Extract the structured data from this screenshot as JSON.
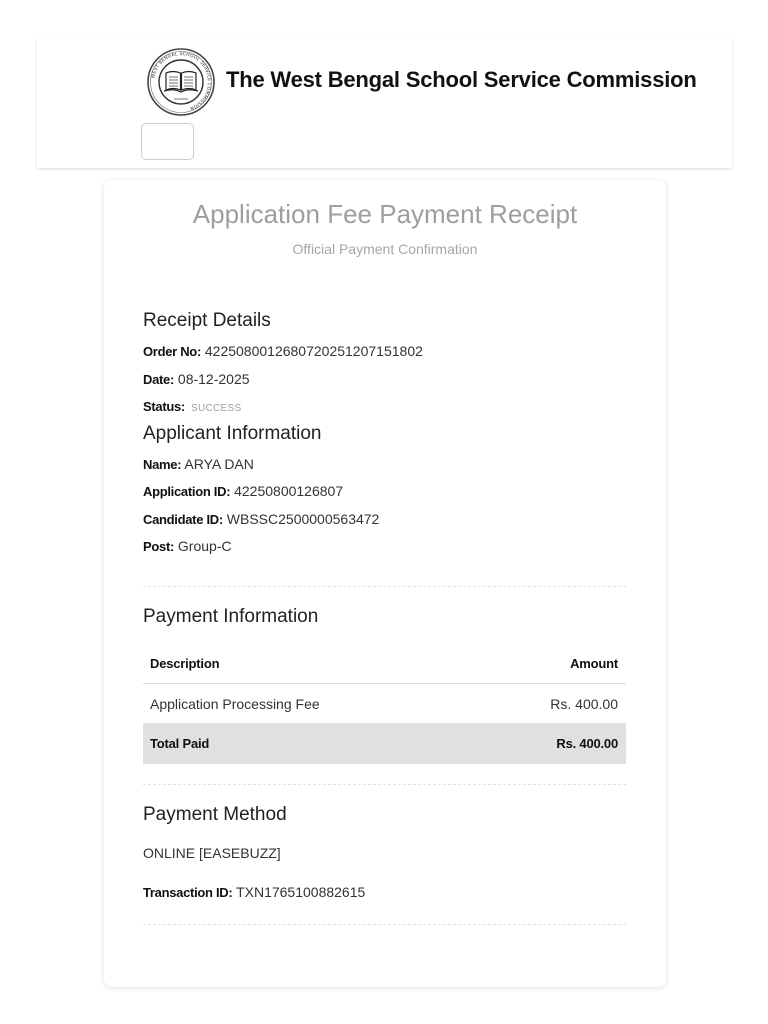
{
  "header": {
    "org_name": "The West Bengal School Service Commission",
    "seal_text": "WEST BENGAL SCHOOL SERVICE COMMISSION"
  },
  "receipt": {
    "title": "Application Fee Payment Receipt",
    "subtitle": "Official Payment Confirmation"
  },
  "receipt_details": {
    "heading": "Receipt Details",
    "order_no_label": "Order No:",
    "order_no": "4225080012680720251207151802",
    "date_label": "Date:",
    "date": "08-12-2025",
    "status_label": "Status:",
    "status": "SUCCESS"
  },
  "applicant": {
    "heading": "Applicant Information",
    "name_label": "Name:",
    "name": "ARYA DAN",
    "application_id_label": "Application ID:",
    "application_id": "42250800126807",
    "candidate_id_label": "Candidate ID:",
    "candidate_id": "WBSSC2500000563472",
    "post_label": "Post:",
    "post": "Group-C"
  },
  "payment": {
    "heading": "Payment Information",
    "columns": [
      "Description",
      "Amount"
    ],
    "rows": [
      {
        "description": "Application Processing Fee",
        "amount": "Rs. 400.00"
      }
    ],
    "total_label": "Total Paid",
    "total_amount": "Rs. 400.00"
  },
  "method": {
    "heading": "Payment Method",
    "value": "ONLINE [EASEBUZZ]",
    "transaction_label": "Transaction ID:",
    "transaction_id": "TXN1765100882615"
  },
  "colors": {
    "title_gray": "#9e9e9e",
    "total_row_bg": "#e0e0e0",
    "page_bg": "#ffffff"
  },
  "icons": {
    "seal": "wbssc-seal-icon"
  }
}
